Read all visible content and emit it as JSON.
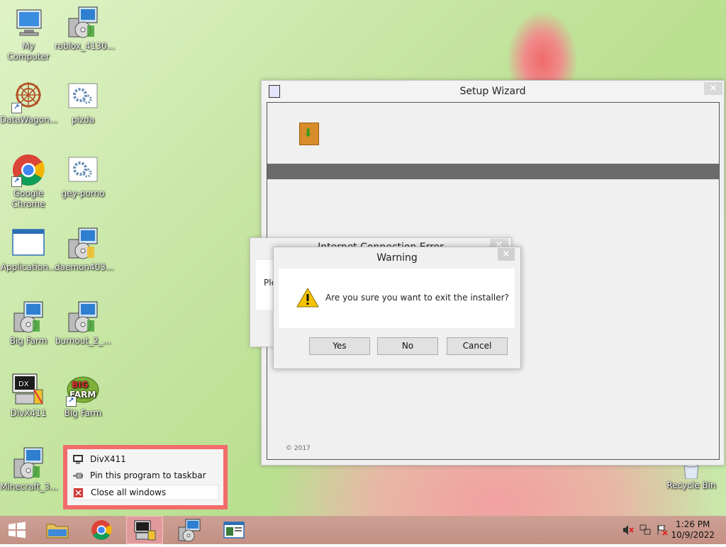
{
  "desktop": {
    "icons": [
      {
        "label": "My Computer",
        "icon": "my-computer-icon"
      },
      {
        "label": "roblox_4130...",
        "icon": "installer-icon"
      },
      {
        "label": "DataWagon...",
        "icon": "datawagon-icon"
      },
      {
        "label": "pizda",
        "icon": "settings-file-icon"
      },
      {
        "label": "Google Chrome",
        "icon": "chrome-icon"
      },
      {
        "label": "gey-porno",
        "icon": "settings-file-icon"
      },
      {
        "label": "Application...",
        "icon": "application-window-icon"
      },
      {
        "label": "daemon403...",
        "icon": "installer-icon"
      },
      {
        "label": "Big Farm",
        "icon": "installer-icon"
      },
      {
        "label": "burnout_2_...",
        "icon": "installer-icon"
      },
      {
        "label": "DivX411",
        "icon": "divx-installer-icon"
      },
      {
        "label": "Big Farm",
        "icon": "big-farm-logo-icon"
      },
      {
        "label": "Minecraft_3...",
        "icon": "installer-icon"
      },
      {
        "label": "Recycle Bin",
        "icon": "recycle-bin-icon"
      }
    ]
  },
  "setup_wizard": {
    "title": "Setup Wizard",
    "close": "×",
    "copyright": "© 2017"
  },
  "connection_error": {
    "title": "Internet Connection Error",
    "text_fragment": "Ple",
    "close": "×"
  },
  "warning": {
    "title": "Warning",
    "close": "×",
    "message": "Are you sure you want to exit the installer?",
    "buttons": {
      "yes": "Yes",
      "no": "No",
      "cancel": "Cancel"
    }
  },
  "jumplist": {
    "items": [
      {
        "label": "DivX411",
        "icon": "divx-icon"
      },
      {
        "label": "Pin this program to taskbar",
        "icon": "pin-icon"
      },
      {
        "label": "Close all windows",
        "icon": "close-icon"
      }
    ]
  },
  "taskbar": {
    "clock_time": "1:26 PM",
    "clock_date": "10/9/2022"
  }
}
